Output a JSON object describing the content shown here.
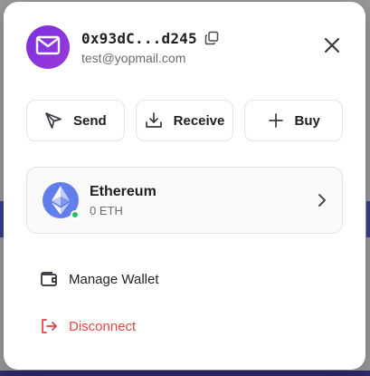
{
  "account": {
    "address": "0x93dC...d245",
    "email": "test@yopmail.com",
    "avatar_icon": "mail-icon",
    "avatar_color": "#8b34dc"
  },
  "actions": {
    "send_label": "Send",
    "receive_label": "Receive",
    "buy_label": "Buy"
  },
  "asset": {
    "name": "Ethereum",
    "balance": "0 ETH",
    "icon": "ethereum-icon",
    "icon_color": "#627eea",
    "status_color": "#22c55e"
  },
  "menu": {
    "manage_label": "Manage Wallet",
    "disconnect_label": "Disconnect",
    "disconnect_color": "#e04646"
  }
}
